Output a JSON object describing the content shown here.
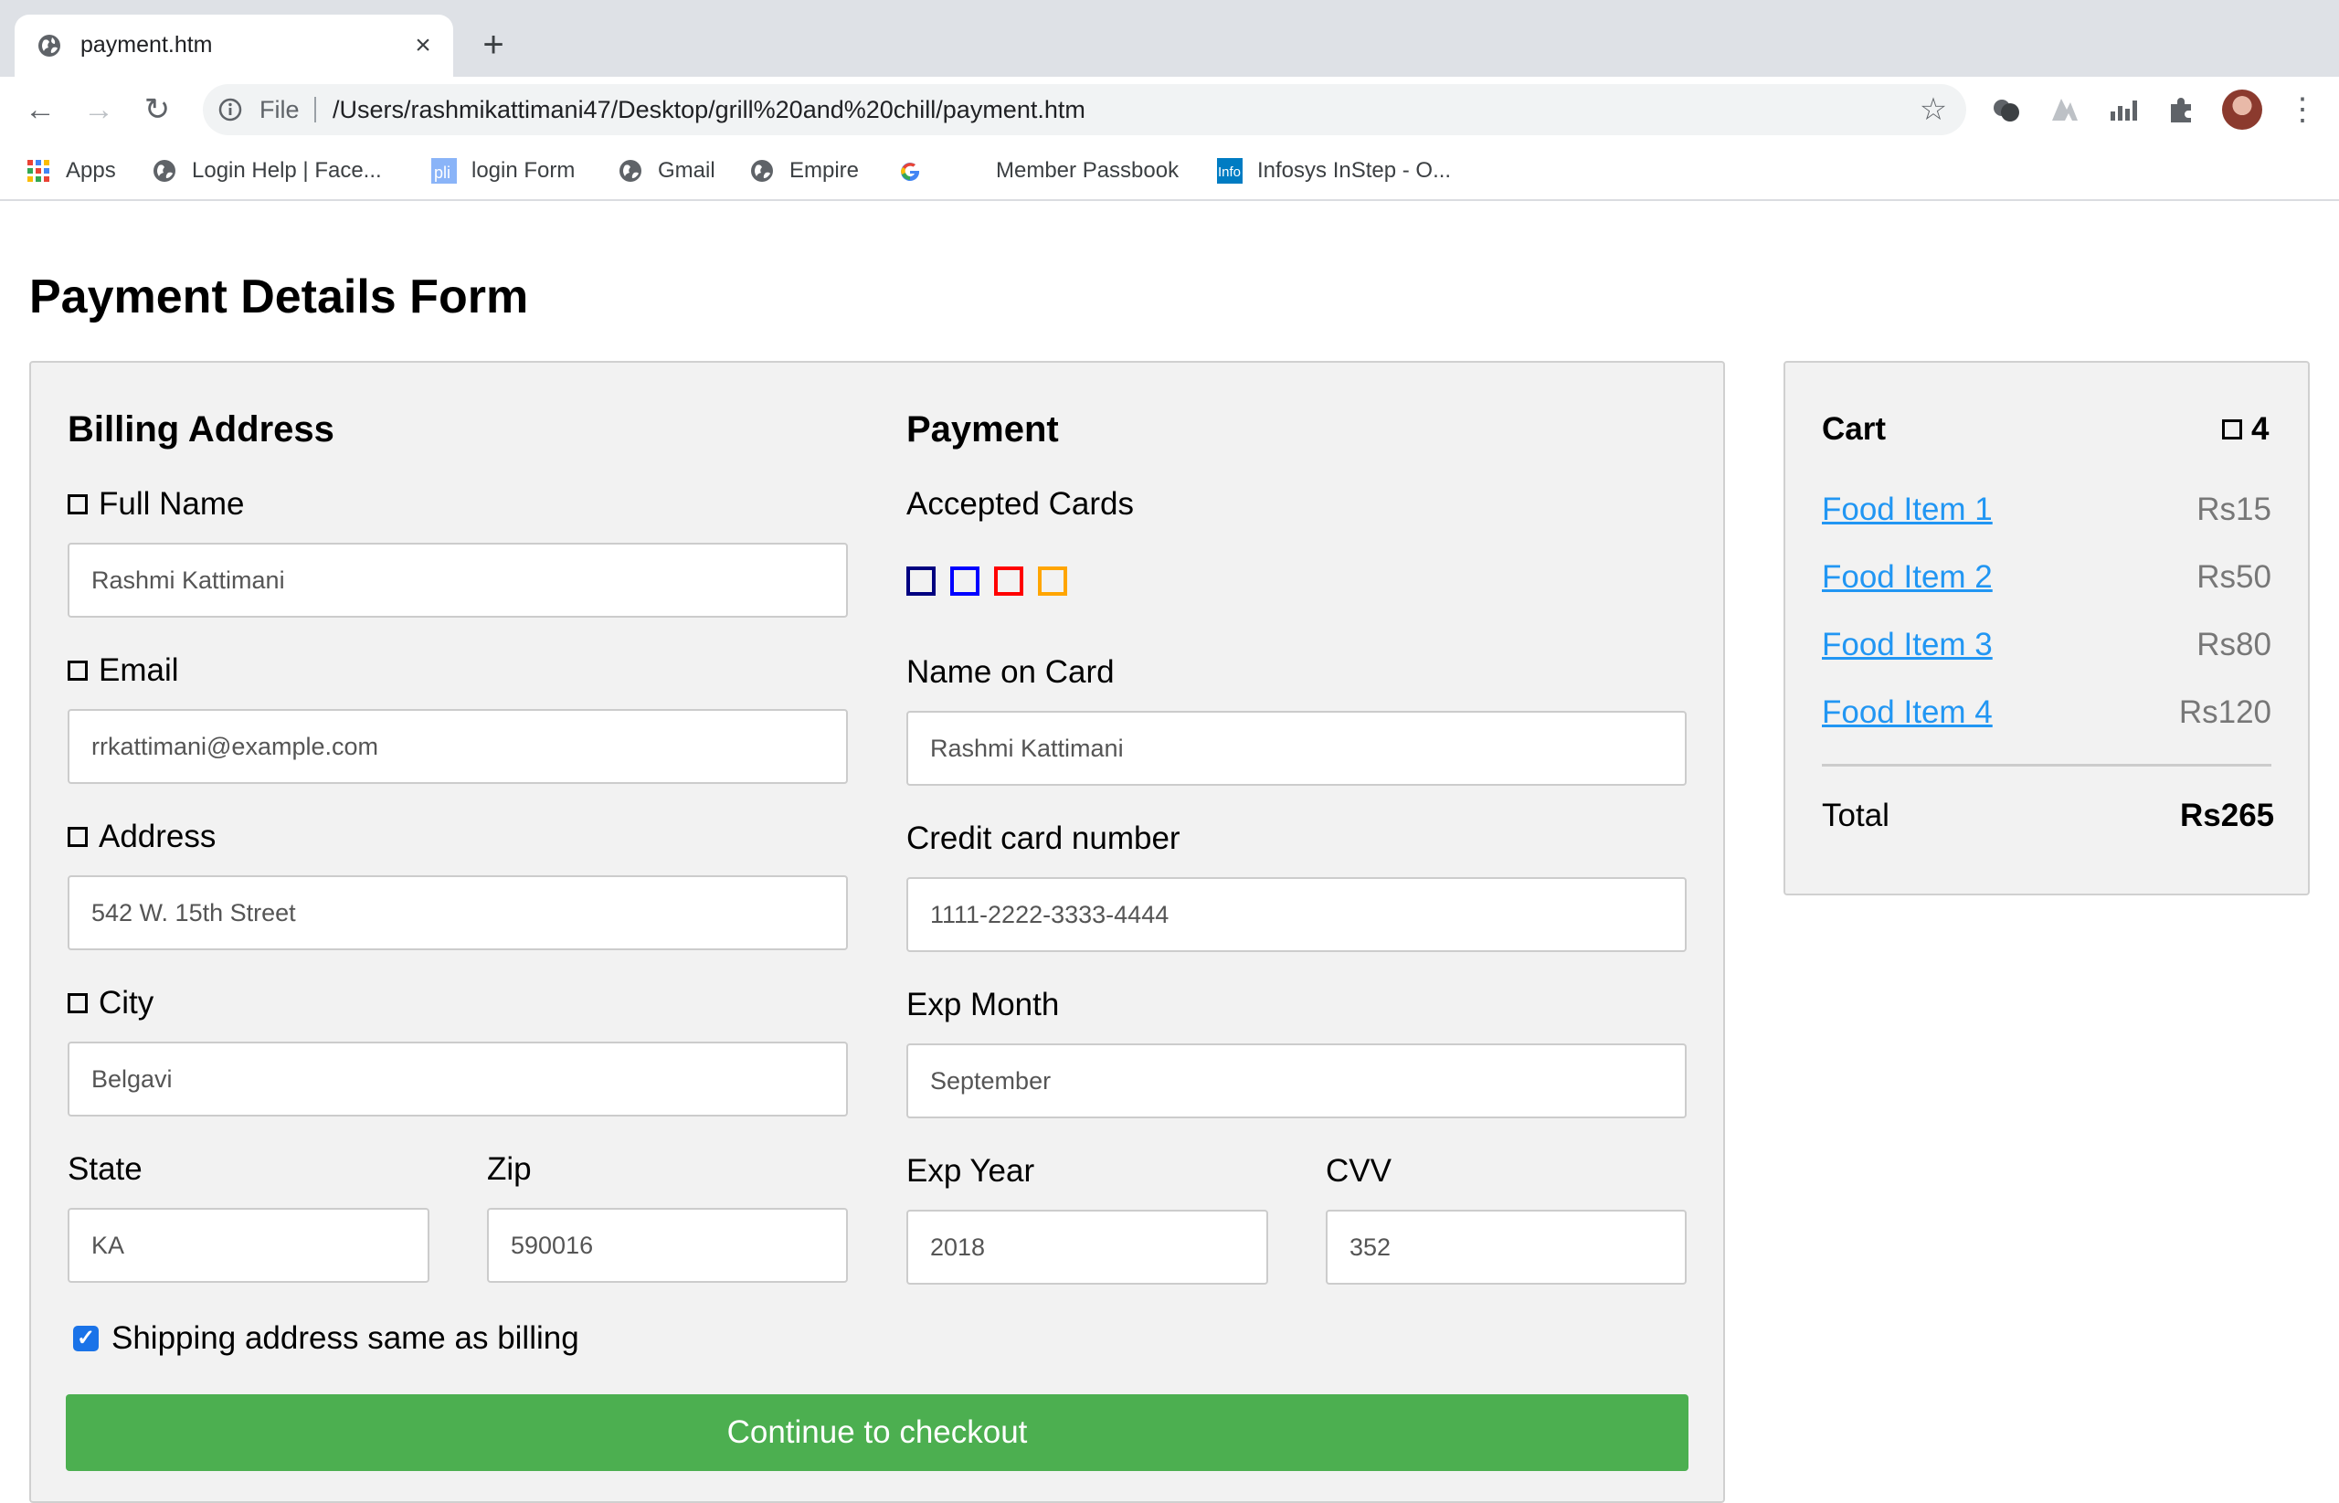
{
  "browser": {
    "tab_title": "payment.htm",
    "new_tab_icon": "plus-icon",
    "url_scheme": "File",
    "url": "/Users/rashmikattimani47/Desktop/grill%20and%20chill/payment.htm"
  },
  "bookmarks": [
    {
      "label": "Apps",
      "icon": "apps-grid-icon"
    },
    {
      "label": "Login Help | Face...",
      "icon": "globe-icon"
    },
    {
      "label": "login Form",
      "icon": "pli-icon"
    },
    {
      "label": "Gmail",
      "icon": "globe-icon"
    },
    {
      "label": "Empire",
      "icon": "globe-icon"
    },
    {
      "label": "",
      "icon": "google-icon"
    },
    {
      "label": "Member Passbook",
      "icon": ""
    },
    {
      "label": "Infosys InStep - O...",
      "icon": "infosys-icon"
    }
  ],
  "page": {
    "title": "Payment Details Form"
  },
  "billing": {
    "heading": "Billing Address",
    "full_name_label": "Full Name",
    "full_name_value": "Rashmi Kattimani",
    "email_label": "Email",
    "email_value": "rrkattimani@example.com",
    "address_label": "Address",
    "address_value": "542 W. 15th Street",
    "city_label": "City",
    "city_value": "Belgavi",
    "state_label": "State",
    "state_value": "KA",
    "zip_label": "Zip",
    "zip_value": "590016"
  },
  "payment": {
    "heading": "Payment",
    "accepted_cards_label": "Accepted Cards",
    "card_colors": [
      "#000080",
      "#0000ff",
      "#ff0000",
      "#ffa500"
    ],
    "name_on_card_label": "Name on Card",
    "name_on_card_value": "Rashmi Kattimani",
    "card_number_label": "Credit card number",
    "card_number_value": "1111-2222-3333-4444",
    "exp_month_label": "Exp Month",
    "exp_month_value": "September",
    "exp_year_label": "Exp Year",
    "exp_year_value": "2018",
    "cvv_label": "CVV",
    "cvv_value": "352"
  },
  "shipping": {
    "same_as_billing_label": "Shipping address same as billing",
    "checked": true
  },
  "checkout": {
    "button_label": "Continue to checkout",
    "button_color": "#4caf50"
  },
  "cart": {
    "title": "Cart",
    "count": "4",
    "items": [
      {
        "name": "Food Item 1",
        "price": "Rs15"
      },
      {
        "name": "Food Item 2",
        "price": "Rs50"
      },
      {
        "name": "Food Item 3",
        "price": "Rs80"
      },
      {
        "name": "Food Item 4",
        "price": "Rs120"
      }
    ],
    "total_label": "Total",
    "total_value": "Rs265",
    "link_color": "#2196f3"
  }
}
